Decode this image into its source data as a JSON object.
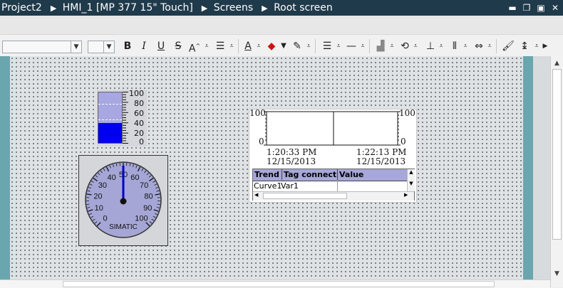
{
  "breadcrumb": [
    "Project2",
    "HMI_1 [MP 377 15\" Touch]",
    "Screens",
    "Root screen"
  ],
  "window_controls": [
    "▬",
    "❐",
    "▣",
    "✕"
  ],
  "toolbar": {
    "bold": "B",
    "italic": "I",
    "underline": "U",
    "strike": "S",
    "font_size_up": "A"
  },
  "bar_widget": {
    "scale_labels": [
      "100",
      "80",
      "60",
      "40",
      "20",
      "0"
    ],
    "level_percent": 40,
    "fill_color": "#0000ee"
  },
  "gauge_widget": {
    "scale_labels": [
      "0",
      "10",
      "20",
      "30",
      "40",
      "50",
      "60",
      "70",
      "80",
      "90",
      "100"
    ],
    "brand": "SIMATIC",
    "value": 50
  },
  "trend_widget": {
    "y_left_max": "100",
    "y_left_min": "0",
    "y_right_max": "100",
    "y_right_min": "0",
    "time_left": "1:20:33 PM",
    "date_left": "12/15/2013",
    "time_right": "1:22:13 PM",
    "date_right": "12/15/2013",
    "columns": [
      "Trend",
      "Tag connection",
      "Value"
    ],
    "rows": [
      {
        "trend": "Curve1",
        "tag": "Var1",
        "value": ""
      }
    ]
  }
}
